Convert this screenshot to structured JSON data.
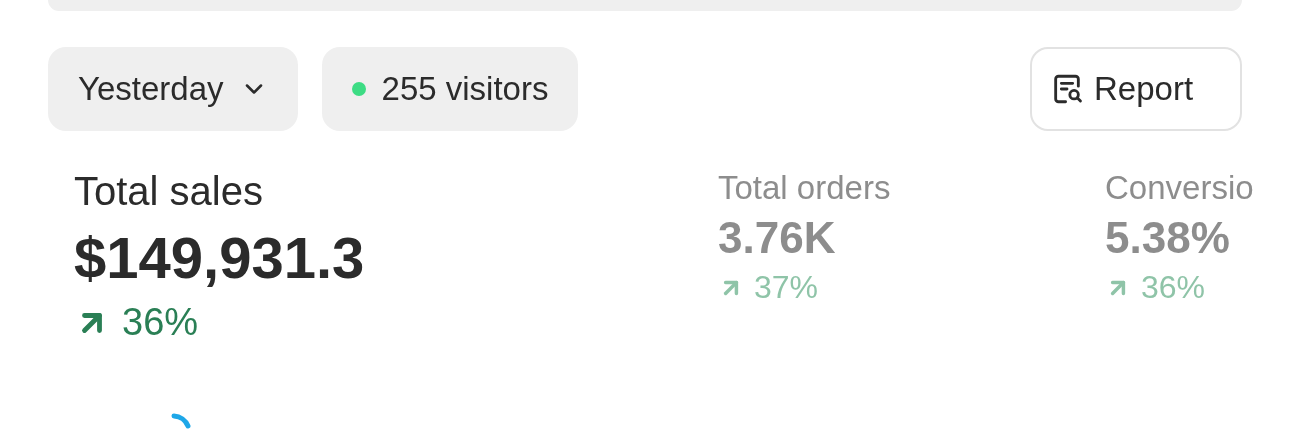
{
  "filters": {
    "period": "Yesterday",
    "visitors": "255 visitors"
  },
  "report_button": "Report",
  "metrics": [
    {
      "label": "Total sales",
      "value": "$149,931.3",
      "change": "36%",
      "selected": true
    },
    {
      "label": "Total orders",
      "value": "3.76K",
      "change": "37%",
      "selected": false
    },
    {
      "label": "Conversio",
      "value": "5.38%",
      "change": "36%",
      "selected": false
    }
  ]
}
